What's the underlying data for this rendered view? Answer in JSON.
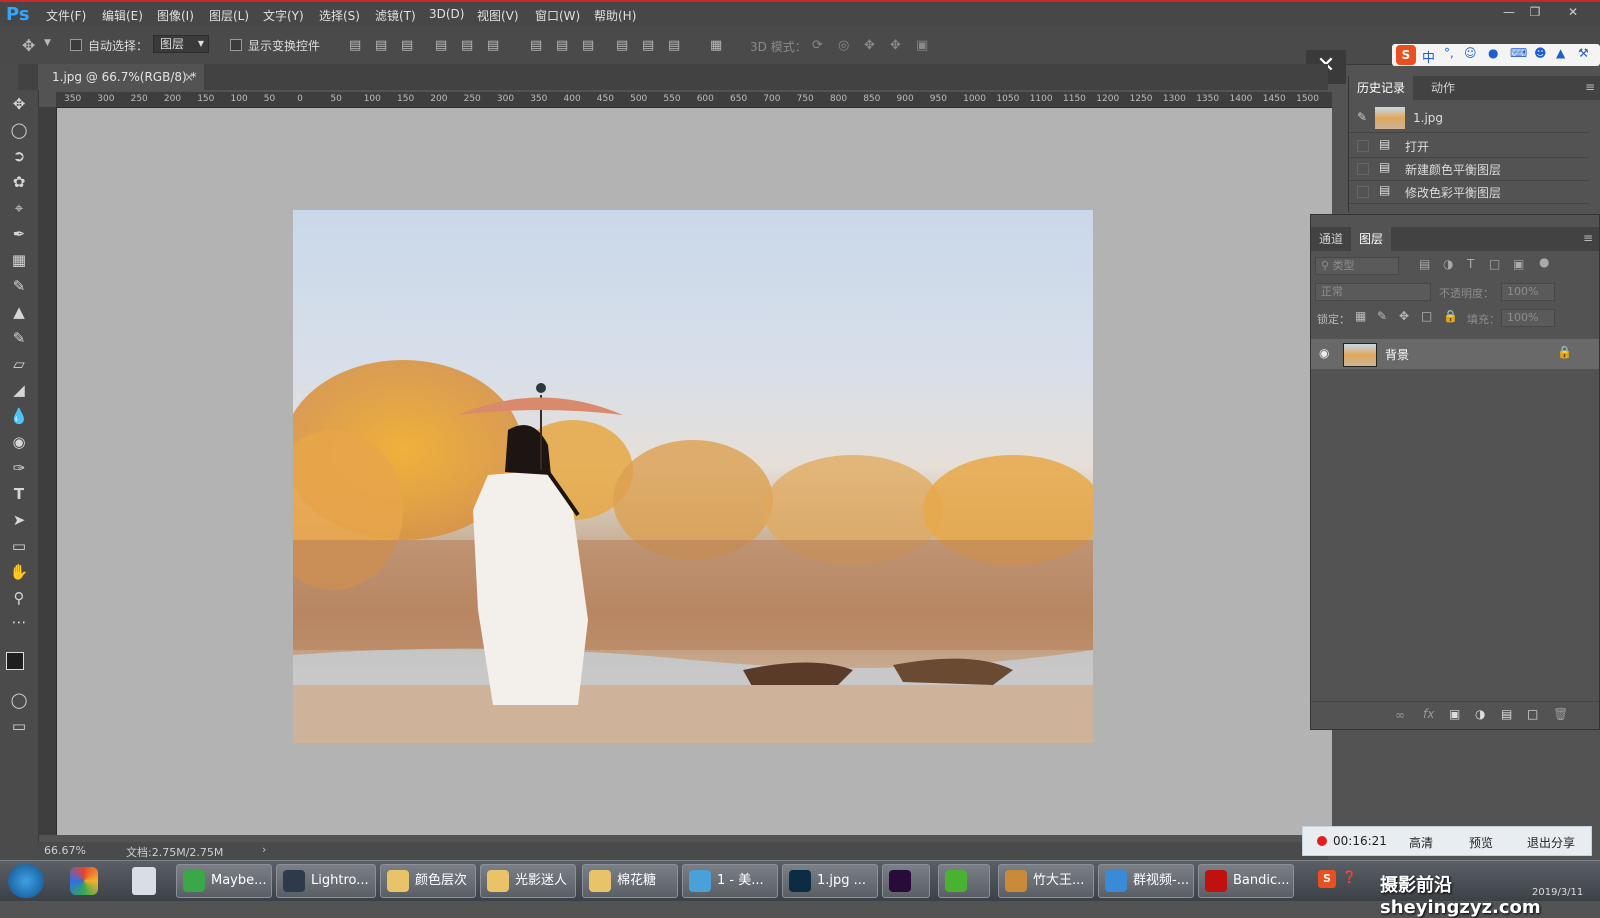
{
  "menubar": {
    "logo": "Ps",
    "items": [
      "文件(F)",
      "编辑(E)",
      "图像(I)",
      "图层(L)",
      "文字(Y)",
      "选择(S)",
      "滤镜(T)",
      "3D(D)",
      "视图(V)",
      "窗口(W)",
      "帮助(H)"
    ]
  },
  "options": {
    "auto_select_label": "自动选择：",
    "auto_select_value": "图层",
    "show_transform_label": "显示变换控件",
    "mode3d_label": "3D 模式："
  },
  "document": {
    "tab_title": "1.jpg @ 66.7%(RGB/8) *",
    "close": "×"
  },
  "ruler": {
    "top_ticks": [
      "350",
      "300",
      "250",
      "200",
      "150",
      "100",
      "50",
      "0",
      "50",
      "100",
      "150",
      "200",
      "250",
      "300",
      "350",
      "400",
      "450",
      "500",
      "550",
      "600",
      "650",
      "700",
      "750",
      "800",
      "850",
      "900",
      "950",
      "1000",
      "1050",
      "1100",
      "1150",
      "1200",
      "1250",
      "1300",
      "1350",
      "1400",
      "1450",
      "1500"
    ]
  },
  "status": {
    "zoom": "66.67%",
    "doc_size": "文档:2.75M/2.75M"
  },
  "history_panel": {
    "tabs": [
      "历史记录",
      "动作"
    ],
    "snapshot_name": "1.jpg",
    "items": [
      "打开",
      "新建颜色平衡图层",
      "修改色彩平衡图层"
    ]
  },
  "layers_panel": {
    "tabs": [
      "通道",
      "图层"
    ],
    "filter_placeholder": "类型",
    "blend_mode": "正常",
    "opacity_label": "不透明度：",
    "opacity_value": "100%",
    "lock_label": "锁定：",
    "fill_label": "填充：",
    "fill_value": "100%",
    "layer_name": "背景"
  },
  "recording": {
    "time": "00:16:21",
    "quality": "高清",
    "preview": "预览",
    "exit": "退出分享"
  },
  "taskbar": {
    "items": [
      {
        "label": "Maybe...",
        "icon": "maybe-icon",
        "color": "#3aa848"
      },
      {
        "label": "Lightro...",
        "icon": "lightroom-icon",
        "color": "#2c3a4a"
      },
      {
        "label": "颜色层次",
        "icon": "folder-icon",
        "color": "#e8c36a"
      },
      {
        "label": "光影迷人",
        "icon": "folder-icon",
        "color": "#e8c36a"
      },
      {
        "label": "棉花糖",
        "icon": "folder-icon",
        "color": "#e8c36a"
      },
      {
        "label": "1 - 美...",
        "icon": "browser-icon",
        "color": "#4aa0d8"
      },
      {
        "label": "1.jpg ...",
        "icon": "photoshop-icon",
        "color": "#0c2b45"
      },
      {
        "label": "",
        "icon": "premiere-icon",
        "color": "#2a0a3a"
      },
      {
        "label": "",
        "icon": "wechat-icon",
        "color": "#49b233"
      },
      {
        "label": "竹大王...",
        "icon": "app-icon",
        "color": "#c98a3a"
      },
      {
        "label": "群视频-...",
        "icon": "qq-video-icon",
        "color": "#3a8ad8"
      },
      {
        "label": "Bandic...",
        "icon": "bandicam-icon",
        "color": "#c01010"
      }
    ],
    "watermark": "摄影前沿 sheyingzyz.com",
    "tray_date": "2019/3/11"
  }
}
